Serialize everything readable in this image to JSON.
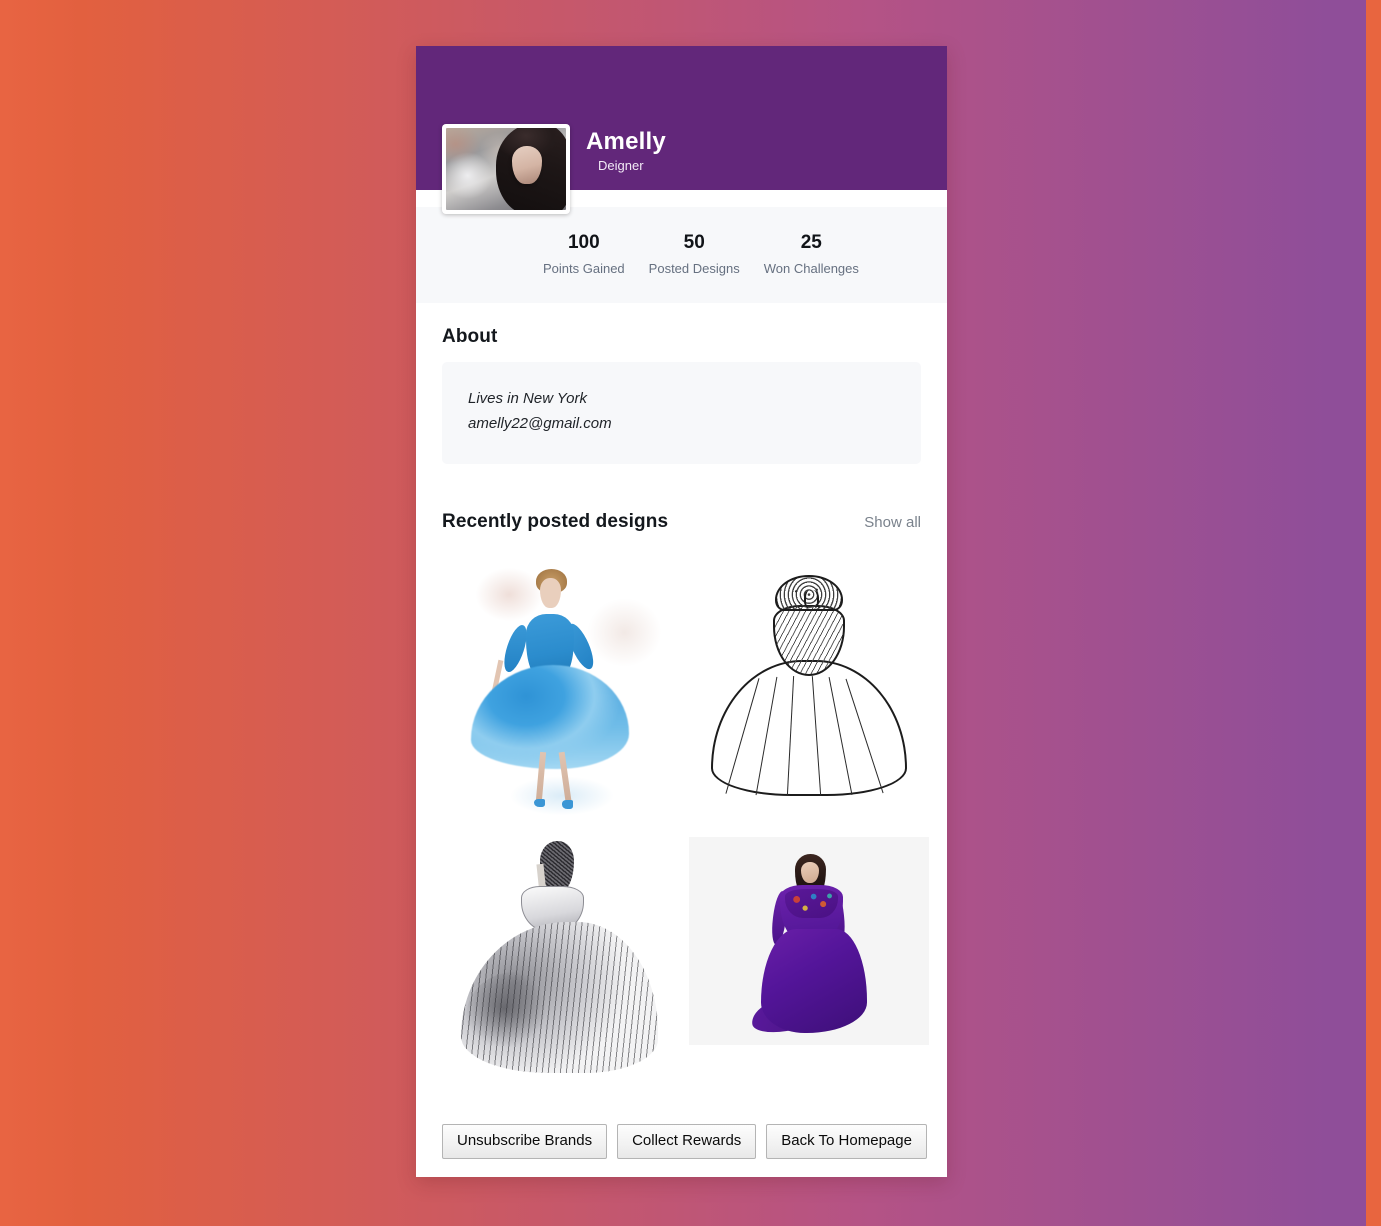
{
  "theme": {
    "banner_color": "#62277a",
    "page_gradient_from": "#e86442",
    "page_gradient_to": "#8f4e99",
    "card_background": "#ffffff",
    "muted_panel": "#f7f8fa"
  },
  "profile": {
    "name": "Amelly",
    "role": "Deigner",
    "avatar_alt": "avatar"
  },
  "stats": [
    {
      "value": "100",
      "label": "Points Gained"
    },
    {
      "value": "50",
      "label": "Posted Designs"
    },
    {
      "value": "25",
      "label": "Won Challenges"
    }
  ],
  "about": {
    "title": "About",
    "lines": [
      "Lives in New York",
      "amelly22@gmail.com"
    ]
  },
  "designs": {
    "title": "Recently posted designs",
    "show_all_label": "Show all",
    "items": [
      {
        "name": "blue-watercolor-dress"
      },
      {
        "name": "white-ballgown-line-art"
      },
      {
        "name": "pencil-sketch-ballgown"
      },
      {
        "name": "purple-mermaid-gown"
      }
    ]
  },
  "actions": [
    {
      "label": "Unsubscribe Brands"
    },
    {
      "label": "Collect Rewards"
    },
    {
      "label": "Back To Homepage"
    }
  ]
}
